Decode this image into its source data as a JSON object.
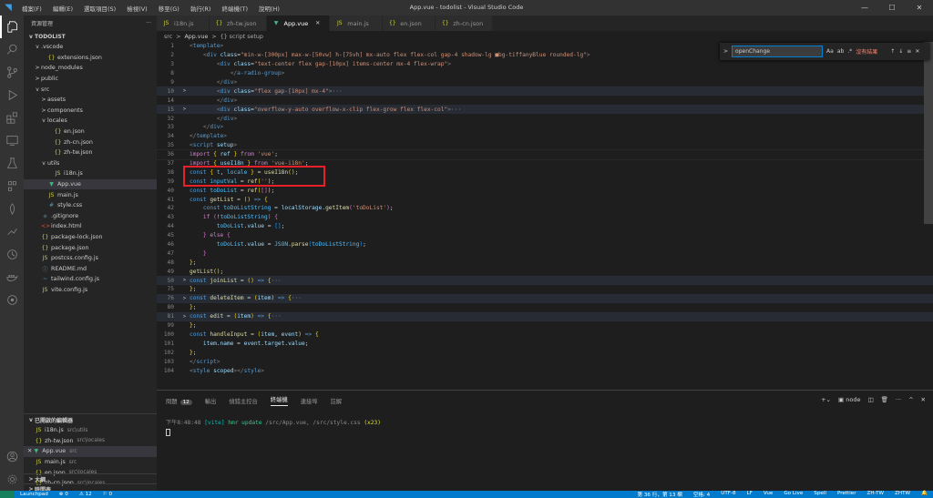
{
  "window": {
    "title": "App.vue - todolist - Visual Studio Code",
    "menu": [
      "檔案(F)",
      "編輯(E)",
      "選取項目(S)",
      "檢視(V)",
      "移至(G)",
      "執行(R)",
      "終端機(T)",
      "說明(H)"
    ]
  },
  "explorer": {
    "header": "資源管理",
    "root": "TODOLIST",
    "items": [
      {
        "label": ".vscode",
        "indent": 1,
        "twisty": "v",
        "icon": ""
      },
      {
        "label": "extensions.json",
        "indent": 2,
        "twisty": "",
        "icon": "{}"
      },
      {
        "label": "node_modules",
        "indent": 1,
        "twisty": ">",
        "icon": ""
      },
      {
        "label": "public",
        "indent": 1,
        "twisty": ">",
        "icon": ""
      },
      {
        "label": "src",
        "indent": 1,
        "twisty": "v",
        "icon": ""
      },
      {
        "label": "assets",
        "indent": 2,
        "twisty": ">",
        "icon": ""
      },
      {
        "label": "components",
        "indent": 2,
        "twisty": ">",
        "icon": ""
      },
      {
        "label": "locales",
        "indent": 2,
        "twisty": "v",
        "icon": ""
      },
      {
        "label": "en.json",
        "indent": 3,
        "twisty": "",
        "icon": "{}"
      },
      {
        "label": "zh-cn.json",
        "indent": 3,
        "twisty": "",
        "icon": "{}"
      },
      {
        "label": "zh-tw.json",
        "indent": 3,
        "twisty": "",
        "icon": "{}"
      },
      {
        "label": "utils",
        "indent": 2,
        "twisty": "v",
        "icon": ""
      },
      {
        "label": "i18n.js",
        "indent": 3,
        "twisty": "",
        "icon": "JS"
      },
      {
        "label": "App.vue",
        "indent": 2,
        "twisty": "",
        "icon": "▼",
        "selected": true
      },
      {
        "label": "main.js",
        "indent": 2,
        "twisty": "",
        "icon": "JS"
      },
      {
        "label": "style.css",
        "indent": 2,
        "twisty": "",
        "icon": "#"
      },
      {
        "label": ".gitignore",
        "indent": 1,
        "twisty": "",
        "icon": "◆"
      },
      {
        "label": "index.html",
        "indent": 1,
        "twisty": "",
        "icon": "<>"
      },
      {
        "label": "package-lock.json",
        "indent": 1,
        "twisty": "",
        "icon": "{}"
      },
      {
        "label": "package.json",
        "indent": 1,
        "twisty": "",
        "icon": "{}"
      },
      {
        "label": "postcss.config.js",
        "indent": 1,
        "twisty": "",
        "icon": "JS"
      },
      {
        "label": "README.md",
        "indent": 1,
        "twisty": "",
        "icon": "ⓘ"
      },
      {
        "label": "tailwind.config.js",
        "indent": 1,
        "twisty": "",
        "icon": "~"
      },
      {
        "label": "vite.config.js",
        "indent": 1,
        "twisty": "",
        "icon": "JS"
      }
    ],
    "open_editors_header": "已開啟的編輯器",
    "open_editors": [
      {
        "name": "i18n.js",
        "path": "src\\utils",
        "icon": "JS"
      },
      {
        "name": "zh-tw.json",
        "path": "src\\locales",
        "icon": "{}"
      },
      {
        "name": "App.vue",
        "path": "src",
        "icon": "▼",
        "selected": true
      },
      {
        "name": "main.js",
        "path": "src",
        "icon": "JS"
      },
      {
        "name": "en.json",
        "path": "src\\locales",
        "icon": "{}"
      },
      {
        "name": "zh-cn.json",
        "path": "src\\locales",
        "icon": "{}"
      }
    ],
    "outline_header": "大綱",
    "timeline_header": "時間表"
  },
  "tabs": [
    {
      "label": "i18n.js",
      "icon": "JS"
    },
    {
      "label": "zh-tw.json",
      "icon": "{}"
    },
    {
      "label": "App.vue",
      "icon": "▼",
      "active": true
    },
    {
      "label": "main.js",
      "icon": "JS"
    },
    {
      "label": "en.json",
      "icon": "{}"
    },
    {
      "label": "zh-cn.json",
      "icon": "{}"
    }
  ],
  "breadcrumb": [
    "src",
    ">",
    "App.vue",
    ">",
    "{} script setup"
  ],
  "find": {
    "query": "openChange",
    "result": "沒有結果"
  },
  "code_lines": [
    {
      "n": "1",
      "fold": "",
      "html": "<span class='t-pun'>&lt;</span><span class='t-tag'>template</span><span class='t-pun'>&gt;</span>"
    },
    {
      "n": "2",
      "fold": "",
      "html": "    <span class='t-pun'>&lt;</span><span class='t-tag'>div</span> <span class='t-attr'>class</span>=<span class='t-str'>\"min-w-[300px] max-w-[50vw] h-[75vh] mx-auto flex flex-col gap-4 shadow-lg ■bg-tiffanyBlue rounded-lg\"</span><span class='t-pun'>&gt;</span>"
    },
    {
      "n": "3",
      "fold": "",
      "html": "        <span class='t-pun'>&lt;</span><span class='t-tag'>div</span> <span class='t-attr'>class</span>=<span class='t-str'>\"text-center flex gap-[10px] items-center mx-4 flex-wrap\"</span><span class='t-pun'>&gt;</span>"
    },
    {
      "n": "8",
      "fold": "",
      "html": "            <span class='t-pun'>&lt;/</span><span class='t-tag'>a-radio-group</span><span class='t-pun'>&gt;</span>"
    },
    {
      "n": "9",
      "fold": "",
      "html": "        <span class='t-pun'>&lt;/</span><span class='t-tag'>div</span><span class='t-pun'>&gt;</span>"
    },
    {
      "n": "10",
      "fold": ">",
      "folded": true,
      "html": "        <span class='t-pun'>&lt;</span><span class='t-tag'>div</span> <span class='t-attr'>class</span>=<span class='t-str'>\"flex gap-[10px] mx-4\"</span><span class='t-pun'>&gt;</span><span class='t-ell'>···</span>"
    },
    {
      "n": "14",
      "fold": "",
      "html": "        <span class='t-pun'>&lt;/</span><span class='t-tag'>div</span><span class='t-pun'>&gt;</span>"
    },
    {
      "n": "15",
      "fold": ">",
      "folded": true,
      "html": "        <span class='t-pun'>&lt;</span><span class='t-tag'>div</span> <span class='t-attr'>class</span>=<span class='t-str'>\"overflow-y-auto overflow-x-clip flex-grow flex flex-col\"</span><span class='t-pun'>&gt;</span><span class='t-ell'>···</span>"
    },
    {
      "n": "32",
      "fold": "",
      "html": "        <span class='t-pun'>&lt;/</span><span class='t-tag'>div</span><span class='t-pun'>&gt;</span>"
    },
    {
      "n": "33",
      "fold": "",
      "html": "    <span class='t-pun'>&lt;/</span><span class='t-tag'>div</span><span class='t-pun'>&gt;</span>"
    },
    {
      "n": "34",
      "fold": "",
      "html": "<span class='t-pun'>&lt;/</span><span class='t-tag'>template</span><span class='t-pun'>&gt;</span>"
    },
    {
      "n": "35",
      "fold": "",
      "html": "<span class='t-pun'>&lt;</span><span class='t-tag'>script</span> <span class='t-attr'>setup</span><span class='t-pun'>&gt;</span>"
    },
    {
      "n": "36",
      "fold": "",
      "cur": true,
      "html": "<span class='t-kw'>import</span> <span class='t-br'>{</span> <span class='t-var'>ref</span> <span class='t-br'>}</span> <span class='t-kw'>from</span> <span class='t-str'>'vue'</span>;"
    },
    {
      "n": "37",
      "fold": "",
      "html": "<span class='t-kw'>import</span> <span class='t-br'>{</span> <span class='t-var'>useI18n</span> <span class='t-br'>}</span> <span class='t-kw'>from</span> <span class='t-str'>'vue-i18n'</span>;"
    },
    {
      "n": "38",
      "fold": "",
      "html": "<span class='t-decl'>const</span> <span class='t-br'>{</span> <span class='t-const'>t</span>, <span class='t-const'>locale</span> <span class='t-br'>}</span> = <span class='t-fn'>useI18n</span><span class='t-br'>()</span>;"
    },
    {
      "n": "39",
      "fold": "",
      "html": "<span class='t-decl'>const</span> <span class='t-const'>inputVal</span> = <span class='t-fn'>ref</span><span class='t-br'>(</span><span class='t-str'>''</span><span class='t-br'>)</span>;"
    },
    {
      "n": "40",
      "fold": "",
      "html": "<span class='t-decl'>const</span> <span class='t-const'>toDoList</span> = <span class='t-fn'>ref</span><span class='t-br'>(</span><span class='t-br2'>[]</span><span class='t-br'>)</span>;"
    },
    {
      "n": "41",
      "fold": "",
      "html": "<span class='t-decl'>const</span> <span class='t-fn'>getList</span> = <span class='t-br'>()</span> <span class='t-decl'>=&gt;</span> <span class='t-br'>{</span>"
    },
    {
      "n": "42",
      "fold": "",
      "html": "    <span class='t-decl'>const</span> <span class='t-const'>toDoListString</span> = <span class='t-var'>localStorage</span>.<span class='t-fn'>getItem</span><span class='t-br2'>(</span><span class='t-str'>'toDoList'</span><span class='t-br2'>)</span>;"
    },
    {
      "n": "43",
      "fold": "",
      "html": "    <span class='t-kw'>if</span> <span class='t-br2'>(</span>!<span class='t-const'>toDoListString</span><span class='t-br2'>)</span> <span class='t-br2'>{</span>"
    },
    {
      "n": "44",
      "fold": "",
      "html": "        <span class='t-const'>toDoList</span>.<span class='t-var'>value</span> = <span class='t-br3'>[]</span>;"
    },
    {
      "n": "45",
      "fold": "",
      "html": "    <span class='t-br2'>}</span> <span class='t-kw'>else</span> <span class='t-br2'>{</span>"
    },
    {
      "n": "46",
      "fold": "",
      "html": "        <span class='t-const'>toDoList</span>.<span class='t-var'>value</span> = <span class='t-const'>JSON</span>.<span class='t-fn'>parse</span><span class='t-br3'>(</span><span class='t-const'>toDoListString</span><span class='t-br3'>)</span>;"
    },
    {
      "n": "47",
      "fold": "",
      "html": "    <span class='t-br2'>}</span>"
    },
    {
      "n": "48",
      "fold": "",
      "html": "<span class='t-br'>}</span>;"
    },
    {
      "n": "49",
      "fold": "",
      "html": "<span class='t-fn'>getList</span><span class='t-br'>()</span>;"
    },
    {
      "n": "50",
      "fold": ">",
      "folded": true,
      "html": "<span class='t-decl'>const</span> <span class='t-fn'>joinList</span> = <span class='t-br'>()</span> <span class='t-decl'>=&gt;</span> <span class='t-br'>{</span><span class='t-ell'>···</span>"
    },
    {
      "n": "75",
      "fold": "",
      "html": "<span class='t-br'>}</span>;"
    },
    {
      "n": "76",
      "fold": ">",
      "folded": true,
      "html": "<span class='t-decl'>const</span> <span class='t-fn'>deleteItem</span> = <span class='t-br'>(</span><span class='t-var'>item</span><span class='t-br'>)</span> <span class='t-decl'>=&gt;</span> <span class='t-br'>{</span><span class='t-ell'>···</span>"
    },
    {
      "n": "80",
      "fold": "",
      "html": "<span class='t-br'>}</span>;"
    },
    {
      "n": "81",
      "fold": ">",
      "folded": true,
      "html": "<span class='t-decl'>const</span> <span class='t-fn'>edit</span> = <span class='t-br'>(</span><span class='t-var'>item</span><span class='t-br'>)</span> <span class='t-decl'>=&gt;</span> <span class='t-br'>{</span><span class='t-ell'>···</span>"
    },
    {
      "n": "99",
      "fold": "",
      "html": "<span class='t-br'>}</span>;"
    },
    {
      "n": "100",
      "fold": "",
      "html": "<span class='t-decl'>const</span> <span class='t-fn'>handleInput</span> = <span class='t-br'>(</span><span class='t-var'>item</span>, <span class='t-var'>event</span><span class='t-br'>)</span> <span class='t-decl'>=&gt;</span> <span class='t-br'>{</span>"
    },
    {
      "n": "101",
      "fold": "",
      "html": "    <span class='t-var'>item</span>.<span class='t-var'>name</span> = <span class='t-var'>event</span>.<span class='t-var'>target</span>.<span class='t-var'>value</span>;"
    },
    {
      "n": "102",
      "fold": "",
      "html": "<span class='t-br'>}</span>;"
    },
    {
      "n": "103",
      "fold": "",
      "html": "<span class='t-pun'>&lt;/</span><span class='t-tag'>script</span><span class='t-pun'>&gt;</span>"
    },
    {
      "n": "104",
      "fold": "",
      "html": "<span class='t-pun'>&lt;</span><span class='t-tag'>style</span> <span class='t-attr'>scoped</span><span class='t-pun'>&gt;&lt;/</span><span class='t-tag'>style</span><span class='t-pun'>&gt;</span>"
    }
  ],
  "panel": {
    "tabs": [
      "問題",
      "輸出",
      "偵錯主控台",
      "終端機",
      "連接埠",
      "註解"
    ],
    "problems_count": "12",
    "active_tab": "終端機",
    "shell": "node",
    "terminal": {
      "time": "下午8:48:48",
      "tag": "[vite]",
      "msg": "hmr update",
      "files": "/src/App.vue, /src/style.css",
      "count": "(x23)"
    }
  },
  "status": {
    "launch": "Launchpad",
    "errors": "⊗ 0",
    "warnings": "⚠ 12",
    "ports": "⚐ 0",
    "position": "第 36 行，第 13 欄",
    "spaces": "空格: 4",
    "encoding": "UTF-8",
    "eol": "LF",
    "lang": "Vue",
    "golive": "Go Live",
    "spell": "Spell",
    "prettier": "Prettier",
    "locale1": "ZH-TW",
    "locale2": "ZHTW"
  },
  "colors": {
    "accent": "#007acc",
    "highlight_box": "#e8202a"
  }
}
